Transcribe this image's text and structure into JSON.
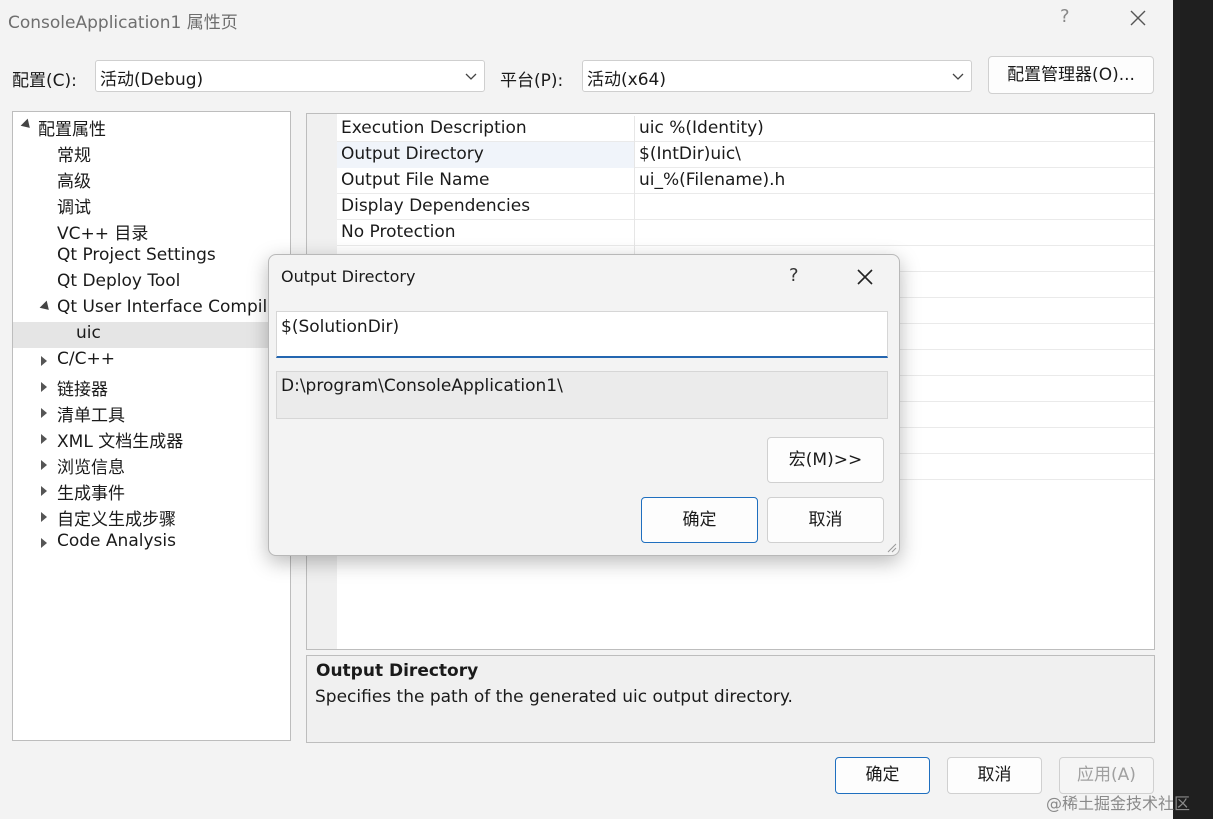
{
  "window": {
    "title": "ConsoleApplication1 属性页",
    "help": "?"
  },
  "toolbar": {
    "config_label": "配置(C):",
    "config_value": "活动(Debug)",
    "platform_label": "平台(P):",
    "platform_value": "活动(x64)",
    "config_manager": "配置管理器(O)..."
  },
  "tree": {
    "items": [
      {
        "label": "配置属性",
        "expander": "expanded"
      },
      {
        "label": "常规"
      },
      {
        "label": "高级"
      },
      {
        "label": "调试"
      },
      {
        "label": "VC++ 目录"
      },
      {
        "label": "Qt Project Settings"
      },
      {
        "label": "Qt Deploy Tool"
      },
      {
        "label": "Qt User Interface Compil",
        "expander": "expanded"
      },
      {
        "label": "uic",
        "selected": true
      },
      {
        "label": "C/C++",
        "expander": "collapsed"
      },
      {
        "label": "链接器",
        "expander": "collapsed"
      },
      {
        "label": "清单工具",
        "expander": "collapsed"
      },
      {
        "label": "XML 文档生成器",
        "expander": "collapsed"
      },
      {
        "label": "浏览信息",
        "expander": "collapsed"
      },
      {
        "label": "生成事件",
        "expander": "collapsed"
      },
      {
        "label": "自定义生成步骤",
        "expander": "collapsed"
      },
      {
        "label": "Code Analysis",
        "expander": "collapsed"
      }
    ]
  },
  "grid": {
    "rows": [
      {
        "name": "Execution Description",
        "value": "uic %(Identity)"
      },
      {
        "name": "Output Directory",
        "value": "$(IntDir)uic\\"
      },
      {
        "name": "Output File Name",
        "value": "ui_%(Filename).h"
      },
      {
        "name": "Display Dependencies",
        "value": ""
      },
      {
        "name": "No Protection",
        "value": ""
      }
    ]
  },
  "description": {
    "title": "Output Directory",
    "text": "Specifies the path of the generated uic output directory."
  },
  "footer": {
    "ok": "确定",
    "cancel": "取消",
    "apply": "应用(A)"
  },
  "dialog": {
    "title": "Output Directory",
    "help": "?",
    "edit_value": "$(SolutionDir)",
    "evaluated_value": "D:\\program\\ConsoleApplication1\\",
    "macros_button": "宏(M)>>",
    "ok": "确定",
    "cancel": "取消"
  },
  "watermark": "@稀土掘金技术社区"
}
